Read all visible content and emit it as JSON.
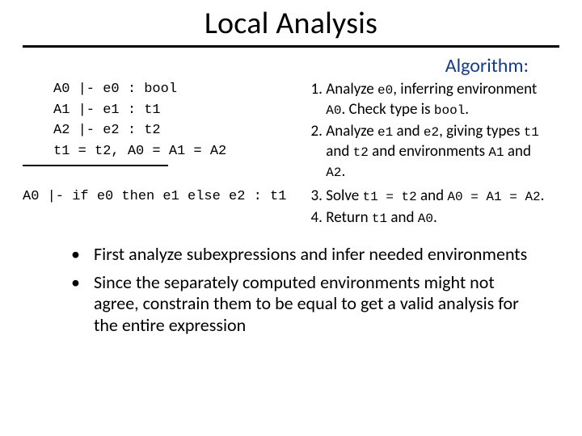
{
  "title": "Local Analysis",
  "algo_heading": {
    "word": "Algorithm",
    "colon": ":"
  },
  "premises": {
    "p1": "A0 |- e0 : bool",
    "p2": "A1 |- e1 : t1",
    "p3": "A2 |- e2 : t2",
    "constraint": "t1 = t2, A0 = A1 = A2"
  },
  "conclusion": "A0 |- if e0 then e1 else e2 : t1",
  "steps": {
    "s1_a": "Analyze ",
    "s1_e0": "e0",
    "s1_b": ", inferring environment ",
    "s1_A0": "A0",
    "s1_c": ". Check type is ",
    "s1_bool": "bool",
    "s1_d": ".",
    "s2_a": "Analyze ",
    "s2_e1": "e1",
    "s2_b": " and ",
    "s2_e2": "e2",
    "s2_c": ", giving types ",
    "s2_t1": "t1",
    "s2_d": " and ",
    "s2_t2": "t2",
    "s2_e": " and environments ",
    "s2_A1": "A1",
    "s2_f": " and ",
    "s2_A2": "A2",
    "s2_g": ".",
    "s3_a": "Solve ",
    "s3_eq1": "t1 = t2",
    "s3_b": " and ",
    "s3_eq2": "A0 = A1 = A2",
    "s3_c": ".",
    "s4_a": "Return ",
    "s4_t1": "t1",
    "s4_b": " and ",
    "s4_A0": "A0",
    "s4_c": "."
  },
  "bullets": {
    "b1": "First analyze subexpressions and infer needed environments",
    "b2": "Since the separately computed environments might not agree, constrain them to be equal to get a valid analysis for the entire expression"
  }
}
